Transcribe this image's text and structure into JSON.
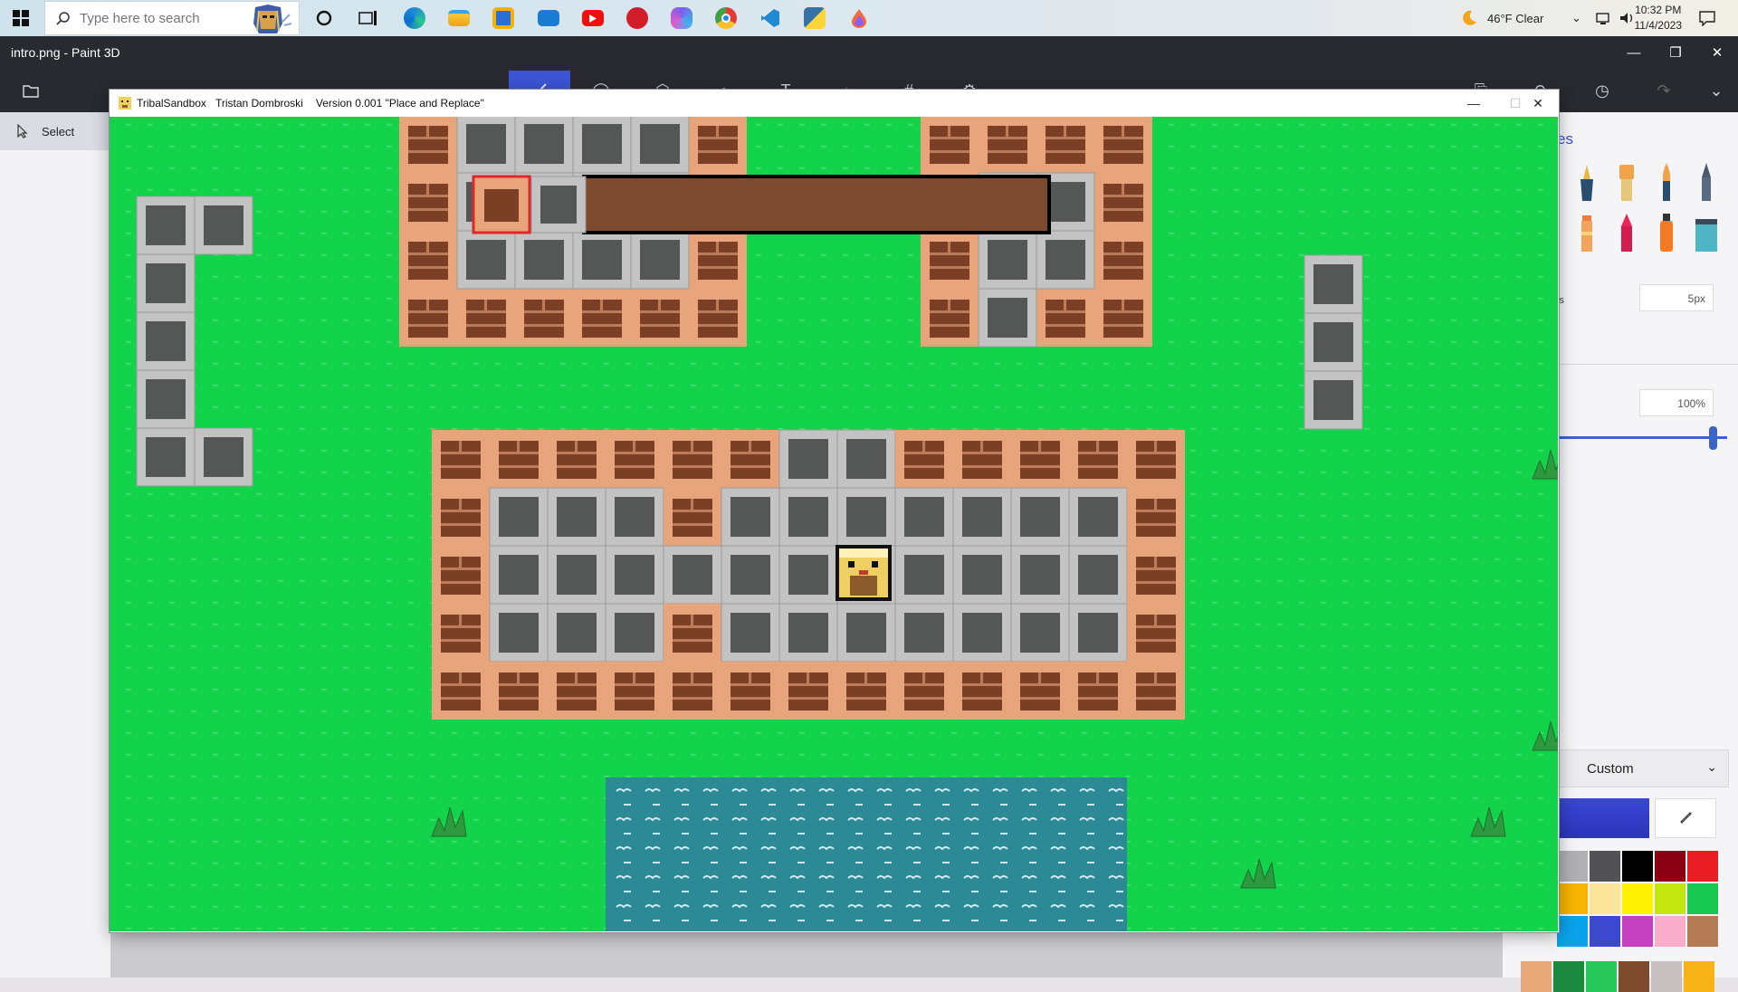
{
  "taskbar": {
    "search_placeholder": "Type here to search",
    "weather": "46°F  Clear",
    "time": "10:32 PM",
    "date": "11/4/2023",
    "apps": [
      "cortana-icon",
      "task-view-icon",
      "edge-icon",
      "file-explorer-icon",
      "store-icon",
      "mail-icon",
      "youtube-icon",
      "app-red-icon",
      "copilot-icon",
      "chrome-icon",
      "vscode-icon",
      "python-icon",
      "paint3d-icon"
    ]
  },
  "paint": {
    "title": "intro.png - Paint 3D",
    "select_label": "Select",
    "panel_title_partial": "es",
    "thickness_partial": "ss",
    "thickness_value": "5px",
    "opacity_value": "100%",
    "color_mode": "Custom",
    "palette": [
      "#b0b0b2",
      "#525254",
      "#000000",
      "#8b0012",
      "#ea1c24",
      "#f7b400",
      "#fde49b",
      "#fff100",
      "#c4e610",
      "#16c750",
      "#0aa2ea",
      "#3c48cd",
      "#c540c0",
      "#fbaec9",
      "#b57b55",
      "#e8a878",
      "#1c8a3e",
      "#27c75a",
      "#7e4a2e",
      "#c7c0c0",
      "#f8b416"
    ],
    "selected_color": "#3b46d6"
  },
  "game": {
    "app_name": "TribalSandbox",
    "author": "Tristan Dombroski",
    "version": "Version 0.001 \"Place and Replace\"",
    "colors": {
      "grass": "#12d34a",
      "brick_bg": "#e8a57c",
      "brick": "#7b3f26",
      "stone_border": "#c3c3c3",
      "stone_fill": "#555656",
      "water": "#2b8a95",
      "hotbar": "#7b4a2f"
    },
    "tile_size": 64,
    "grid_cols": 25,
    "grid_rows": 14,
    "tiles": {
      "brick": [
        [
          5,
          0
        ],
        [
          6,
          0
        ],
        [
          7,
          0
        ],
        [
          8,
          0
        ],
        [
          9,
          0
        ],
        [
          5,
          1
        ],
        [
          5,
          2
        ],
        [
          5,
          3
        ],
        [
          6,
          3
        ],
        [
          7,
          3
        ],
        [
          8,
          3
        ],
        [
          9,
          3
        ],
        [
          10,
          1
        ],
        [
          10,
          2
        ],
        [
          10,
          3
        ],
        [
          14,
          0
        ],
        [
          15,
          0
        ],
        [
          16,
          0
        ],
        [
          17,
          0
        ],
        [
          14,
          1
        ],
        [
          14,
          2
        ],
        [
          14,
          3
        ],
        [
          17,
          1
        ],
        [
          17,
          2
        ],
        [
          16,
          3
        ],
        [
          17,
          3
        ],
        [
          6,
          6
        ],
        [
          7,
          6
        ],
        [
          8,
          6
        ],
        [
          9,
          6
        ],
        [
          10,
          6
        ],
        [
          11,
          6
        ],
        [
          12,
          6
        ],
        [
          15,
          6
        ],
        [
          16,
          6
        ],
        [
          17,
          6
        ],
        [
          18,
          6
        ],
        [
          19,
          6
        ],
        [
          6,
          7
        ],
        [
          6,
          8
        ],
        [
          6,
          9
        ],
        [
          6,
          10
        ],
        [
          7,
          10
        ],
        [
          8,
          10
        ],
        [
          9,
          10
        ],
        [
          10,
          10
        ],
        [
          11,
          10
        ],
        [
          12,
          10
        ],
        [
          13,
          10
        ],
        [
          14,
          10
        ],
        [
          15,
          10
        ],
        [
          16,
          10
        ],
        [
          17,
          10
        ],
        [
          18,
          10
        ],
        [
          19,
          10
        ],
        [
          19,
          7
        ],
        [
          19,
          8
        ],
        [
          19,
          9
        ],
        [
          11,
          7
        ],
        [
          11,
          9
        ]
      ],
      "stone": [
        [
          6,
          0
        ],
        [
          7,
          0
        ],
        [
          8,
          0
        ],
        [
          9,
          0
        ],
        [
          6,
          1
        ],
        [
          7,
          1
        ],
        [
          8,
          1
        ],
        [
          9,
          1
        ],
        [
          6,
          2
        ],
        [
          7,
          2
        ],
        [
          8,
          2
        ],
        [
          9,
          2
        ],
        [
          15,
          1
        ],
        [
          16,
          1
        ],
        [
          15,
          2
        ],
        [
          16,
          2
        ],
        [
          15,
          3
        ],
        [
          0,
          1
        ],
        [
          1,
          1
        ],
        [
          0,
          2
        ],
        [
          0,
          3
        ],
        [
          0,
          4
        ],
        [
          0,
          5
        ],
        [
          1,
          5
        ],
        [
          20,
          2
        ],
        [
          20,
          3
        ],
        [
          20,
          4
        ],
        [
          13,
          6
        ],
        [
          14,
          6
        ],
        [
          7,
          7
        ],
        [
          8,
          7
        ],
        [
          9,
          7
        ],
        [
          12,
          7
        ],
        [
          13,
          7
        ],
        [
          14,
          7
        ],
        [
          15,
          7
        ],
        [
          16,
          7
        ],
        [
          17,
          7
        ],
        [
          18,
          7
        ],
        [
          7,
          8
        ],
        [
          8,
          8
        ],
        [
          9,
          8
        ],
        [
          10,
          8
        ],
        [
          11,
          8
        ],
        [
          12,
          8
        ],
        [
          13,
          8
        ],
        [
          15,
          8
        ],
        [
          16,
          8
        ],
        [
          17,
          8
        ],
        [
          18,
          8
        ],
        [
          7,
          9
        ],
        [
          8,
          9
        ],
        [
          9,
          9
        ],
        [
          12,
          9
        ],
        [
          13,
          9
        ],
        [
          14,
          9
        ],
        [
          15,
          9
        ],
        [
          16,
          9
        ],
        [
          17,
          9
        ],
        [
          18,
          9
        ]
      ],
      "brick_only": [
        [
          5,
          0
        ],
        [
          5,
          1
        ],
        [
          5,
          2
        ],
        [
          5,
          3
        ],
        [
          6,
          3
        ],
        [
          7,
          3
        ],
        [
          8,
          3
        ],
        [
          9,
          3
        ],
        [
          10,
          3
        ],
        [
          10,
          0
        ],
        [
          10,
          1
        ],
        [
          10,
          2
        ],
        [
          14,
          0
        ],
        [
          14,
          1
        ],
        [
          14,
          2
        ],
        [
          14,
          3
        ],
        [
          17,
          0
        ],
        [
          17,
          1
        ],
        [
          17,
          2
        ],
        [
          17,
          3
        ],
        [
          15,
          0
        ],
        [
          16,
          0
        ],
        [
          16,
          3
        ]
      ]
    },
    "hotbar": {
      "slots": 2,
      "selected": 0
    },
    "player": "character-sprite",
    "bushes": 5
  }
}
